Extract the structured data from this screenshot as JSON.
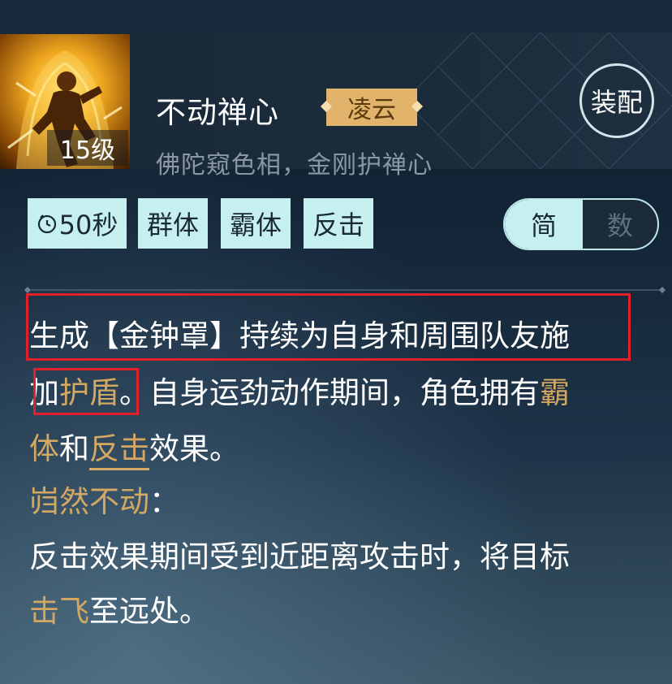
{
  "skill": {
    "name": "不动禅心",
    "faction": "凌云",
    "subtitle": "佛陀窥色相，金刚护禅心",
    "level": "15级",
    "equip_label": "装配"
  },
  "tags": {
    "cooldown": "50秒",
    "items": [
      "群体",
      "霸体",
      "反击"
    ]
  },
  "toggle": {
    "simple": "简",
    "numeric": "数",
    "active": "简"
  },
  "description": {
    "line1": "生成【金钟罩】持续为自身和周围队友施",
    "line2_a": "加",
    "line2_shield": "护盾",
    "line2_b": "。自身运劲动作期间，角色拥有",
    "line2_ba": "霸",
    "line3_ti": "体",
    "line3_and": "和",
    "line3_counter": "反击",
    "line3_end": "效果。",
    "passive_name": "岿然不动",
    "passive_colon": "：",
    "line5": "反击效果期间受到近距离攻击时，将目标",
    "line6_knock": "击飞",
    "line6_end": "至远处。"
  },
  "colors": {
    "accent_gold": "#d4a862",
    "tag_bg": "#c6eff0",
    "highlight_red": "#e0202a",
    "faction_bg": "#e1b36b"
  }
}
